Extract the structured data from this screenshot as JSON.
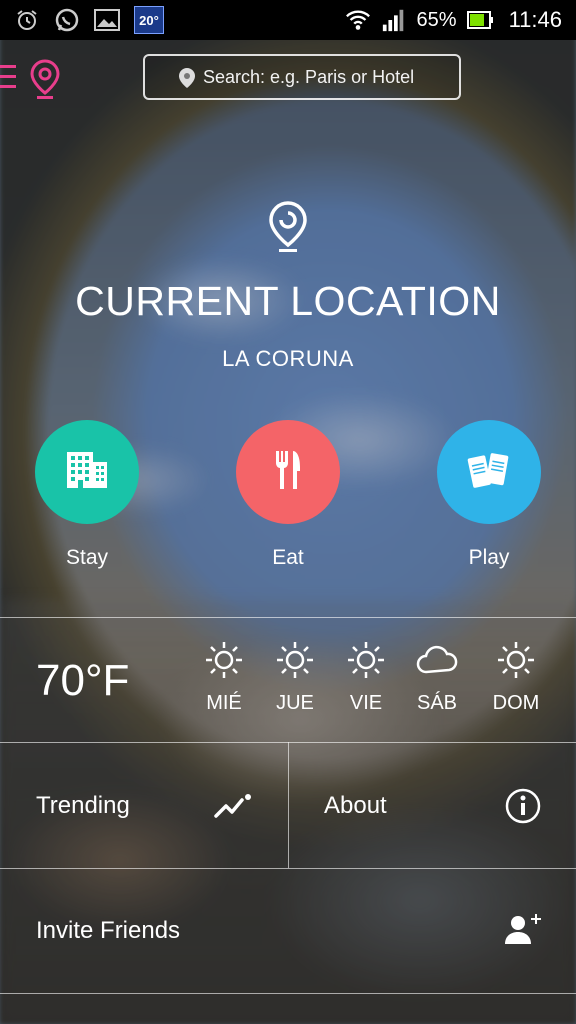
{
  "status_bar": {
    "weather_temp": "20°",
    "battery_percent": "65%",
    "time": "11:46",
    "icons": [
      "alarm-icon",
      "whatsapp-icon",
      "gallery-icon",
      "weather-widget-icon",
      "wifi-icon",
      "signal-icon",
      "battery-icon"
    ]
  },
  "header": {
    "search_placeholder": "Search: e.g. Paris or Hotel",
    "accent_color": "#e83e8c"
  },
  "location": {
    "title": "CURRENT LOCATION",
    "city": "LA CORUNA"
  },
  "categories": [
    {
      "label": "Stay",
      "icon": "hotel-icon",
      "color": "#19c3a8"
    },
    {
      "label": "Eat",
      "icon": "fork-knife-icon",
      "color": "#f46468"
    },
    {
      "label": "Play",
      "icon": "tickets-icon",
      "color": "#2fb3e8"
    }
  ],
  "weather": {
    "current_temp": "70°F",
    "forecast": [
      {
        "day": "MIÉ",
        "icon": "sun-icon"
      },
      {
        "day": "JUE",
        "icon": "sun-icon"
      },
      {
        "day": "VIE",
        "icon": "sun-icon"
      },
      {
        "day": "SÁB",
        "icon": "cloud-icon"
      },
      {
        "day": "DOM",
        "icon": "sun-icon"
      }
    ]
  },
  "menu": {
    "trending": "Trending",
    "about": "About",
    "invite": "Invite Friends"
  }
}
